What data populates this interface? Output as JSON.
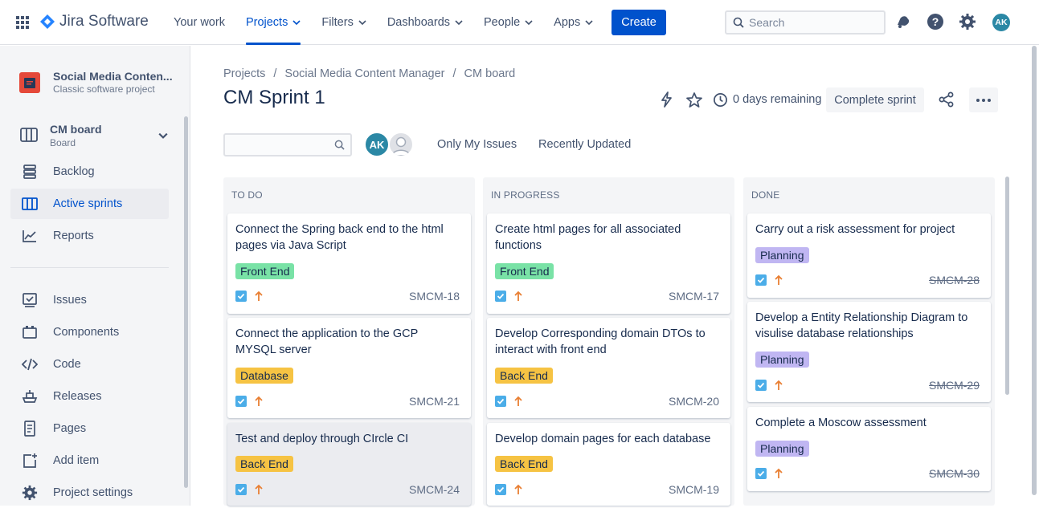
{
  "topnav": {
    "product_name": "Jira Software",
    "items": [
      {
        "label": "Your work"
      },
      {
        "label": "Projects"
      },
      {
        "label": "Filters"
      },
      {
        "label": "Dashboards"
      },
      {
        "label": "People"
      },
      {
        "label": "Apps"
      }
    ],
    "create_label": "Create",
    "search_placeholder": "Search",
    "user_initials": "AK",
    "accent_color": "#0052cc"
  },
  "sidebar": {
    "project_name": "Social Media Content Manager",
    "project_name_display": "Social Media Conten...",
    "project_type": "Classic software project",
    "board_name": "CM board",
    "board_type": "Board",
    "items": [
      {
        "label": "Backlog",
        "icon": "backlog-icon"
      },
      {
        "label": "Active sprints",
        "icon": "board-icon"
      },
      {
        "label": "Reports",
        "icon": "reports-icon"
      },
      {
        "label": "Issues",
        "icon": "issues-icon"
      },
      {
        "label": "Components",
        "icon": "components-icon"
      },
      {
        "label": "Code",
        "icon": "code-icon"
      },
      {
        "label": "Releases",
        "icon": "releases-icon"
      },
      {
        "label": "Pages",
        "icon": "pages-icon"
      },
      {
        "label": "Add item",
        "icon": "add-item-icon"
      },
      {
        "label": "Project settings",
        "icon": "settings-icon"
      }
    ]
  },
  "breadcrumb": [
    "Projects",
    "Social Media Content Manager",
    "CM board"
  ],
  "breadcrumb_sep": "/",
  "page_title": "CM Sprint 1",
  "header": {
    "days_remaining": "0 days remaining",
    "complete_label": "Complete sprint"
  },
  "filters": {
    "avatar_initials": "AK",
    "only_my_issues": "Only My Issues",
    "recently_updated": "Recently Updated"
  },
  "columns": [
    {
      "title": "TO DO",
      "cards": [
        {
          "title": "Connect the Spring back end to the html pages via Java Script",
          "label": "Front End",
          "key": "SMCM-18"
        },
        {
          "title": "Connect the application to the GCP MYSQL server",
          "label": "Database",
          "key": "SMCM-21"
        },
        {
          "title": "Test and deploy through CIrcle CI",
          "label": "Back End",
          "key": "SMCM-24"
        }
      ]
    },
    {
      "title": "IN PROGRESS",
      "cards": [
        {
          "title": "Create html pages for all associated functions",
          "label": "Front End",
          "key": "SMCM-17"
        },
        {
          "title": "Develop Corresponding domain DTOs to interact with front end",
          "label": "Back End",
          "key": "SMCM-20"
        },
        {
          "title": "Develop domain pages for each database",
          "label": "Back End",
          "key": "SMCM-19"
        }
      ]
    },
    {
      "title": "DONE",
      "cards": [
        {
          "title": "Carry out a risk assessment for project",
          "label": "Planning",
          "key": "SMCM-28"
        },
        {
          "title": "Develop a Entity Relationship Diagram to visulise database relationships",
          "label": "Planning",
          "key": "SMCM-29"
        },
        {
          "title": "Complete a Moscow assessment",
          "label": "Planning",
          "key": "SMCM-30"
        }
      ]
    }
  ],
  "label_colors": {
    "Front End": "#79e2a6",
    "Database": "#f6c343",
    "Back End": "#f6c343",
    "Planning": "#c0b6f2"
  }
}
